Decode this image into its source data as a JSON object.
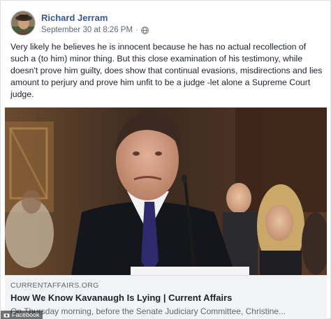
{
  "post": {
    "author": "Richard Jerram",
    "timestamp": "September 30 at 8:26 PM",
    "separator": "·",
    "privacy_icon": "globe-icon",
    "text": "Very likely he believes he is innocent because he has no actual recollection of such a (to him) minor thing. But this close examination of his testimony, while doesn't prove him guilty, does show that continual evasions, misdirections and lies amount to perjury and prove him unfit to be a judge -let alone a Supreme Court judge."
  },
  "link_preview": {
    "domain": "CURRENTAFFAIRS.ORG",
    "title": "How We Know Kavanaugh Is Lying | Current Affairs",
    "description": "On Thursday morning, before the Senate Judiciary Committee, Christine..."
  },
  "watermark": {
    "text": "Facebook"
  },
  "colors": {
    "author_link": "#365899",
    "meta_text": "#616770",
    "preview_bg": "#f2f3f5"
  }
}
